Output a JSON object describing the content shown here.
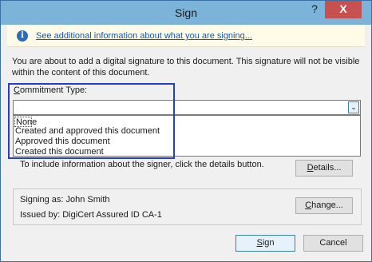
{
  "window": {
    "title": "Sign",
    "help_icon": "?",
    "close_icon": "X"
  },
  "infobar": {
    "icon": "i",
    "link": "See additional information about what you are signing..."
  },
  "description": "You are about to add a digital signature to this document. This signature will not be visible within the content of this document.",
  "commitment": {
    "label_first": "C",
    "label_rest": "ommitment Type:",
    "selected_value": "",
    "dropdown_arrow": "⌄",
    "options": [
      "None",
      "Created and approved this document",
      "Approved this document",
      "Created this document"
    ]
  },
  "details": {
    "text": "To include information about the signer, click the details button.",
    "button_label_first": "D",
    "button_label_rest": "etails..."
  },
  "signer": {
    "signing_as_label": "Signing as:",
    "signing_as_value": "John Smith",
    "issued_by_label": "Issued by:",
    "issued_by_value": "DigiCert Assured ID CA-1",
    "change_label_first": "C",
    "change_label_rest": "hange..."
  },
  "buttons": {
    "sign_first": "S",
    "sign_rest": "ign",
    "cancel": "Cancel"
  }
}
